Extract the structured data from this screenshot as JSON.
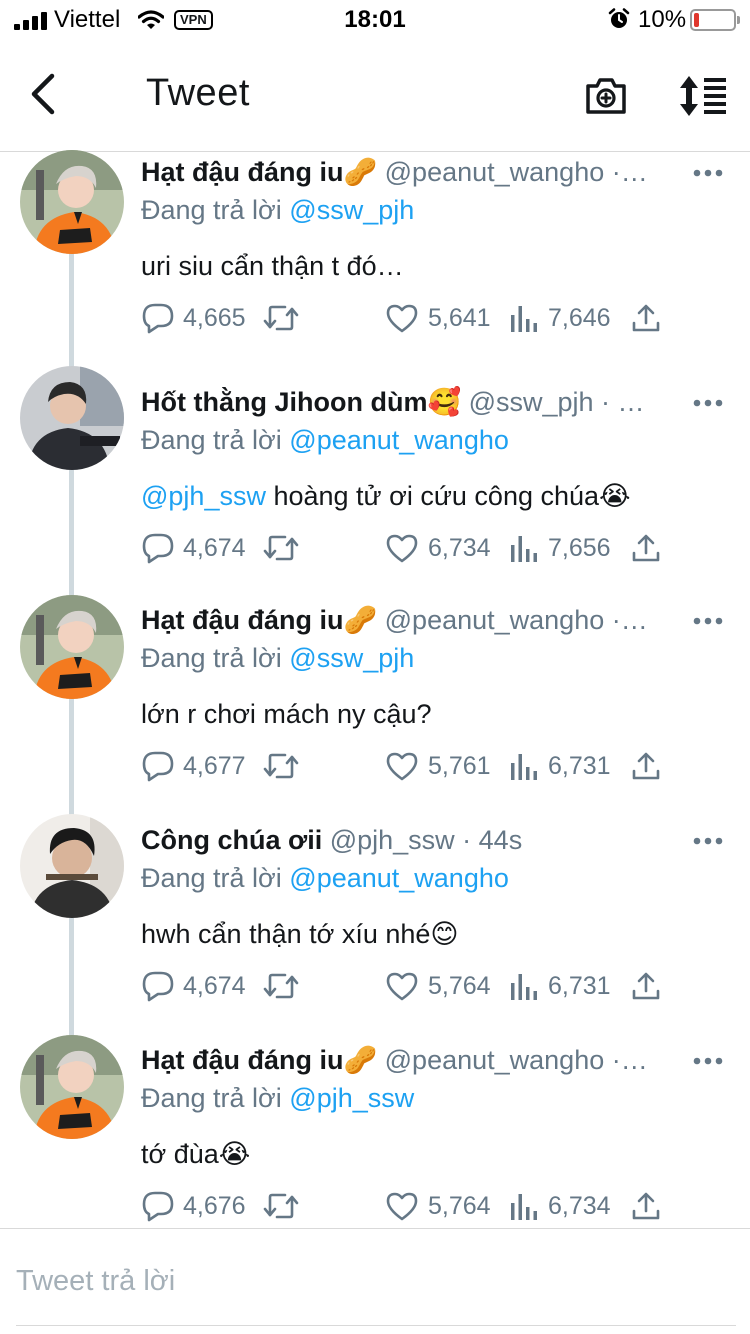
{
  "status_bar": {
    "carrier": "Viettel",
    "vpn": "VPN",
    "time": "18:01",
    "battery": "10%"
  },
  "nav": {
    "title": "Tweet",
    "icons": [
      "back-chevron-icon",
      "camera-add-icon",
      "sort-list-icon"
    ]
  },
  "labels": {
    "replying_to": "Đang trả lời"
  },
  "tweets": [
    {
      "name": "Hạt đậu đáng iu🥜",
      "handle": "@peanut_wangho ·…",
      "reply_to": "@ssw_pjh",
      "text": "uri siu cẩn thận t đó…",
      "text_mention": "",
      "replies": "4,665",
      "likes": "5,641",
      "views": "7,646",
      "avatar": "orange-jersey"
    },
    {
      "name": "Hốt thằng Jihoon dùm🥰",
      "handle": "@ssw_pjh · …",
      "reply_to": "@peanut_wangho",
      "text": " hoàng tử ơi cứu công chúa😭",
      "text_mention": "@pjh_ssw",
      "replies": "4,674",
      "likes": "6,734",
      "views": "7,656",
      "avatar": "dark-hoodie"
    },
    {
      "name": "Hạt đậu đáng iu🥜",
      "handle": "@peanut_wangho ·…",
      "reply_to": "@ssw_pjh",
      "text": "lớn r chơi mách ny cậu?",
      "text_mention": "",
      "replies": "4,677",
      "likes": "5,761",
      "views": "6,731",
      "avatar": "orange-jersey"
    },
    {
      "name": "Công chúa ơii",
      "handle": "@pjh_ssw · 44s",
      "reply_to": "@peanut_wangho",
      "text": "hwh cẩn thận tớ xíu nhé😊",
      "text_mention": "",
      "replies": "4,674",
      "likes": "5,764",
      "views": "6,731",
      "avatar": "dark-hair"
    },
    {
      "name": "Hạt đậu đáng iu🥜",
      "handle": "@peanut_wangho ·…",
      "reply_to": "@pjh_ssw",
      "text": "tớ đùa😭",
      "text_mention": "",
      "replies": "4,676",
      "likes": "5,764",
      "views": "6,734",
      "avatar": "orange-jersey"
    }
  ],
  "composer": {
    "placeholder": "Tweet trả lời"
  },
  "colors": {
    "accent": "#1da1f2",
    "text": "#14171a",
    "muted": "#657786",
    "thread_line": "#cfd9de",
    "battery_low": "#e0372d"
  }
}
